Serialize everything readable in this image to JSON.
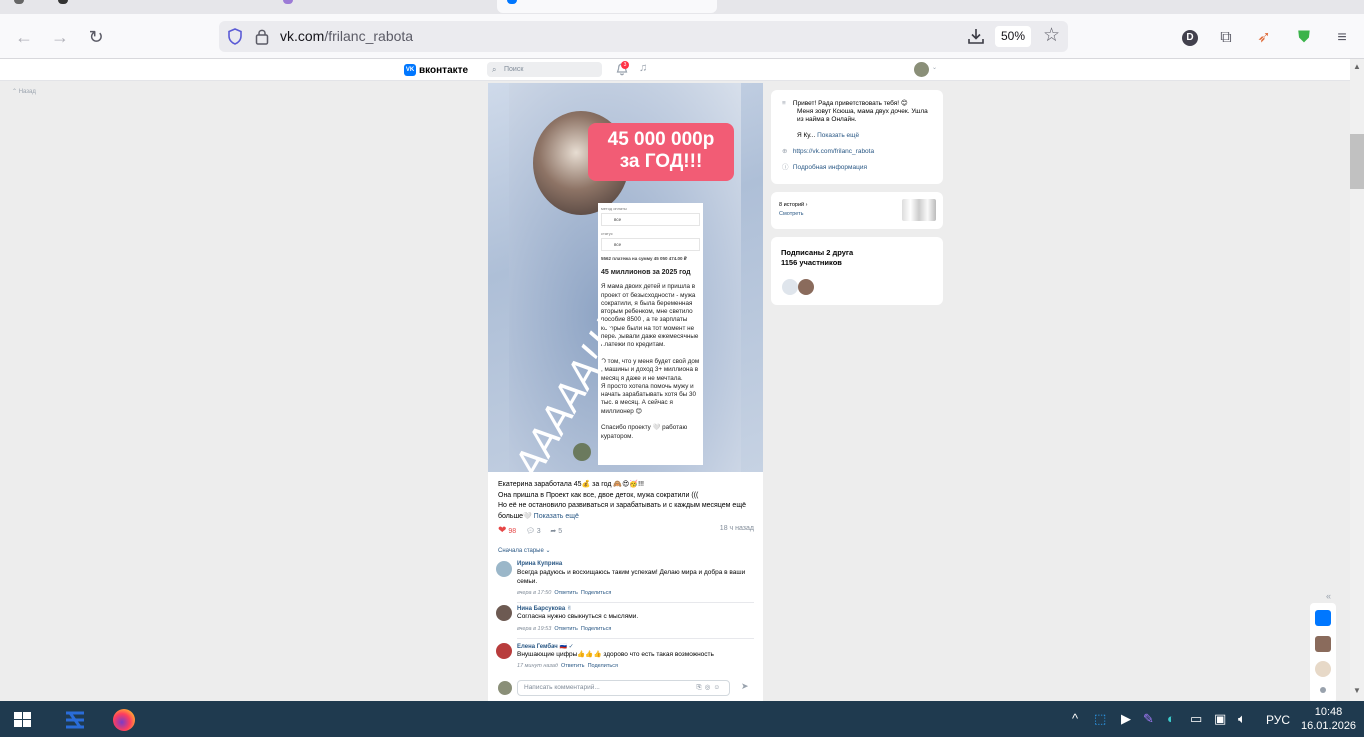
{
  "browser": {
    "url_host": "vk.com",
    "url_path": "/frilanc_rabota",
    "zoom": "50%",
    "profile_initial": "D"
  },
  "vk": {
    "logo_text": "вконтакте",
    "search_placeholder": "Поиск",
    "notif_count": "3",
    "back_label": "Назад"
  },
  "post": {
    "image": {
      "promo_line1": "45 000 000р",
      "promo_line2": "за ГОД!!!",
      "label_method": "метод оплаты",
      "select1": "все",
      "label_status": "статус",
      "select2": "все",
      "sum_line": "5562 платежа на сумму 45 050 474.00 ₽",
      "screen_title": "45 миллионов за 2025 год",
      "screen_p1": "Я мама двоих детей и пришла в проект от безысходности - мужа сократили, я была беременная вторым ребенком, мне светило пособие 8500 , а те зарплаты которые были на тот момент не перекрывали даже ежемесячные платежи по кредитам.",
      "screen_p2": "О том, что у меня будет свой дом , машины и доход 3+ миллиона в месяц я даже и не мечтала.",
      "screen_p3": "Я просто хотела помочь мужу и начать зарабатывать хотя бы 30 тыс. в месяц. А сейчас я миллионер 😊",
      "screen_p4": "Спасибо проекту 🤍 работаю куратором.",
      "handwriting": "ААААА!!!"
    },
    "text_line1": "Екатерина заработала 45💰 за год 🙈😍🥳!!!",
    "text_line2": "Она пришла в Проект как все, двое деток, мужа сократили (((",
    "text_line3": "Но её не остановило развиваться и зарабатывать и с каждым месяцем ещё",
    "text_line4": "больше🤍",
    "show_more": "Показать ещё",
    "likes": "98",
    "comments": "3",
    "shares": "5",
    "time": "18 ч назад",
    "sort_label": "Сначала старые ⌄",
    "comment_placeholder": "Написать комментарий..."
  },
  "comments": [
    {
      "name": "Ирина Куприна",
      "text": "Всегда радуюсь и восхищаюсь таким успехам! Делаю мира и добра в ваши семьи.",
      "time": "вчера в 17:50",
      "reply": "Ответить",
      "share": "Поделиться"
    },
    {
      "name": "Нина Барсукова ✌",
      "text": "Согласна нужно свыкнуться с мыслями.",
      "time": "вчера в 19:53",
      "reply": "Ответить",
      "share": "Поделиться"
    },
    {
      "name": "Елена Гембач 🇷🇺 ✓",
      "text": "Внушающие цифры👍👍👍 здорово что есть такая возможность",
      "time": "17 минут назад",
      "reply": "Ответить",
      "share": "Поделиться"
    }
  ],
  "about": {
    "bio_line1": "Привет! Рада приветствовать тебя! 😊",
    "bio_line2": "Меня зовут Ксюша, мама двух дочек. Ушла",
    "bio_line3": "из найма в Онлайн.",
    "bio_line4": "Я Ку...",
    "show_more": "Показать ещё",
    "link": "https://vk.com/frilanc_rabota",
    "details": "Подробная информация"
  },
  "stories": {
    "title": "8 историй ›",
    "watch": "Смотреть"
  },
  "subs": {
    "friends": "Подписаны 2 друга",
    "members": "1156 участников"
  },
  "taskbar": {
    "lang": "РУС",
    "time": "10:48",
    "date": "16.01.2026"
  }
}
